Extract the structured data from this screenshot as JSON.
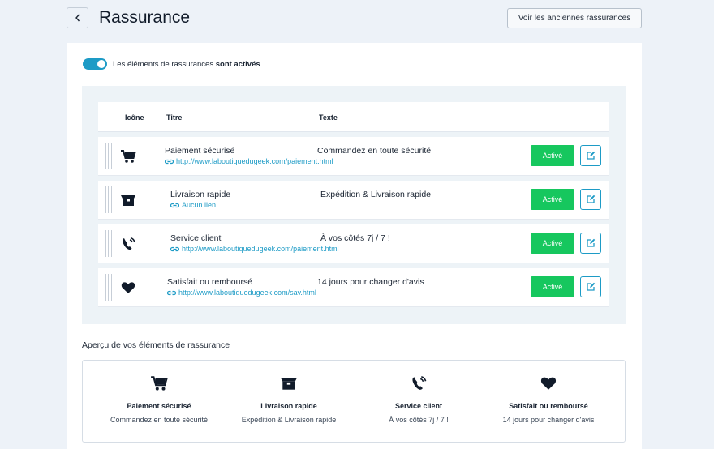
{
  "header": {
    "title": "Rassurance",
    "old_button": "Voir les anciennes rassurances"
  },
  "toggle": {
    "label_prefix": "Les éléments de rassurances",
    "label_bold": "sont activés",
    "enabled": true
  },
  "table": {
    "col_icon": "Icône",
    "col_title": "Titre",
    "col_text": "Texte",
    "rows": [
      {
        "icon": "cart-icon",
        "title": "Paiement sécurisé",
        "link": "http://www.laboutiquedugeek.com/paiement.html",
        "text": "Commandez en toute sécurité",
        "status": "Activé"
      },
      {
        "icon": "box-icon",
        "title": "Livraison rapide",
        "link": "Aucun lien",
        "text": "Expédition & Livraison rapide",
        "status": "Activé"
      },
      {
        "icon": "phone-icon",
        "title": "Service client",
        "link": "http://www.laboutiquedugeek.com/paiement.html",
        "text": "À vos côtés 7j / 7 !",
        "status": "Activé"
      },
      {
        "icon": "heart-icon",
        "title": "Satisfait ou remboursé",
        "link": "http://www.laboutiquedugeek.com/sav.html",
        "text": "14 jours pour changer d'avis",
        "status": "Activé"
      }
    ]
  },
  "preview": {
    "heading": "Aperçu de vos éléments de rassurance",
    "items": [
      {
        "icon": "cart-icon",
        "title": "Paiement sécurisé",
        "text": "Commandez en toute sécurité"
      },
      {
        "icon": "box-icon",
        "title": "Livraison rapide",
        "text": "Expédition & Livraison rapide"
      },
      {
        "icon": "phone-icon",
        "title": "Service client",
        "text": "À vos côtés 7j / 7 !"
      },
      {
        "icon": "heart-icon",
        "title": "Satisfait ou remboursé",
        "text": "14 jours pour changer d'avis"
      }
    ]
  },
  "colors": {
    "accent": "#1d9bc6",
    "active_green": "#16c75e",
    "background": "#edf2f8"
  }
}
